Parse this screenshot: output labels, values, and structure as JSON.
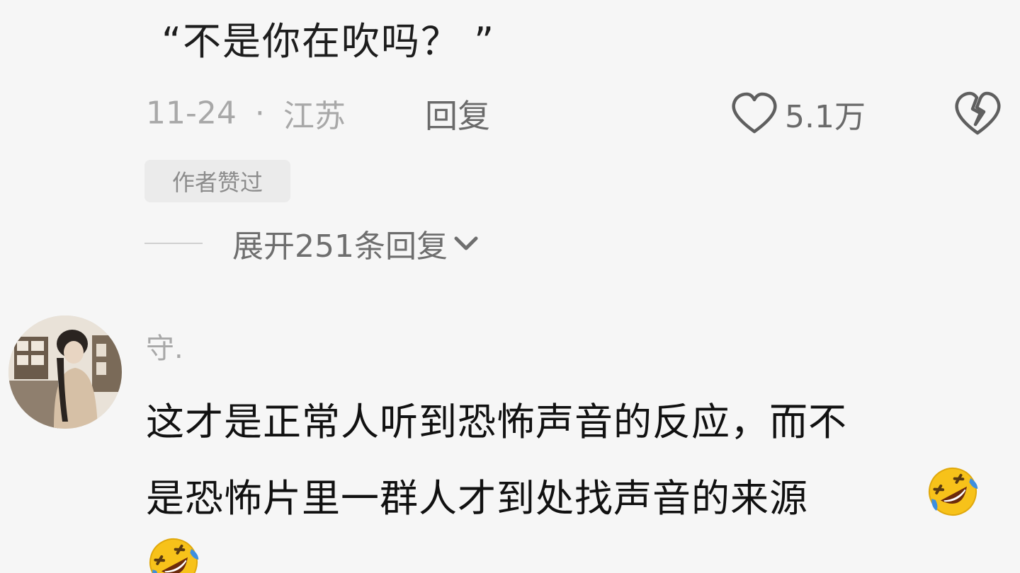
{
  "top_comment": {
    "text": "“不是你在吹吗？ ”",
    "date": "11-24",
    "separator": "·",
    "location": "江苏",
    "reply_label": "回复",
    "like_count": "5.1万",
    "badge": "作者赞过",
    "expand_replies": "展开251条回复"
  },
  "comment": {
    "username": "守.",
    "text_line_1": "这才是正常人听到恐怖声音的反应，而不",
    "text_line_2": "是恐怖片里一群人才到处找声音的来源"
  },
  "colors": {
    "background": "#f6f6f6",
    "primary_text": "#111111",
    "secondary_text": "#a8a8a8",
    "emoji_yellow": "#f7c21a",
    "emoji_tear": "#3d8fe0"
  },
  "icons": [
    "heart-icon",
    "broken-heart-icon",
    "chevron-down-icon",
    "rofl-emoji-icon"
  ]
}
